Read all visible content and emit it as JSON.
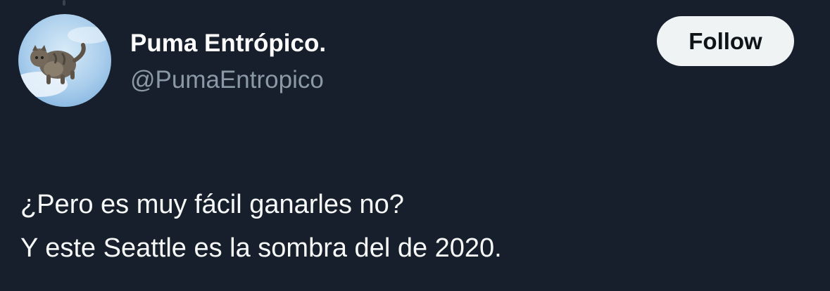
{
  "author": {
    "display_name": "Puma Entrópico.",
    "handle": "@PumaEntropico",
    "avatar_icon": "cat-floating-in-sky-avatar"
  },
  "actions": {
    "follow_label": "Follow"
  },
  "tweet": {
    "lines": [
      "¿Pero es muy fácil ganarles no?",
      "Y este Seattle es la sombra del de 2020."
    ]
  },
  "colors": {
    "background": "#15202b",
    "name": "#ffffff",
    "handle": "#8b98a5",
    "text": "#f7f9f9",
    "follow_bg": "#eff3f4",
    "follow_text": "#0f1419"
  }
}
